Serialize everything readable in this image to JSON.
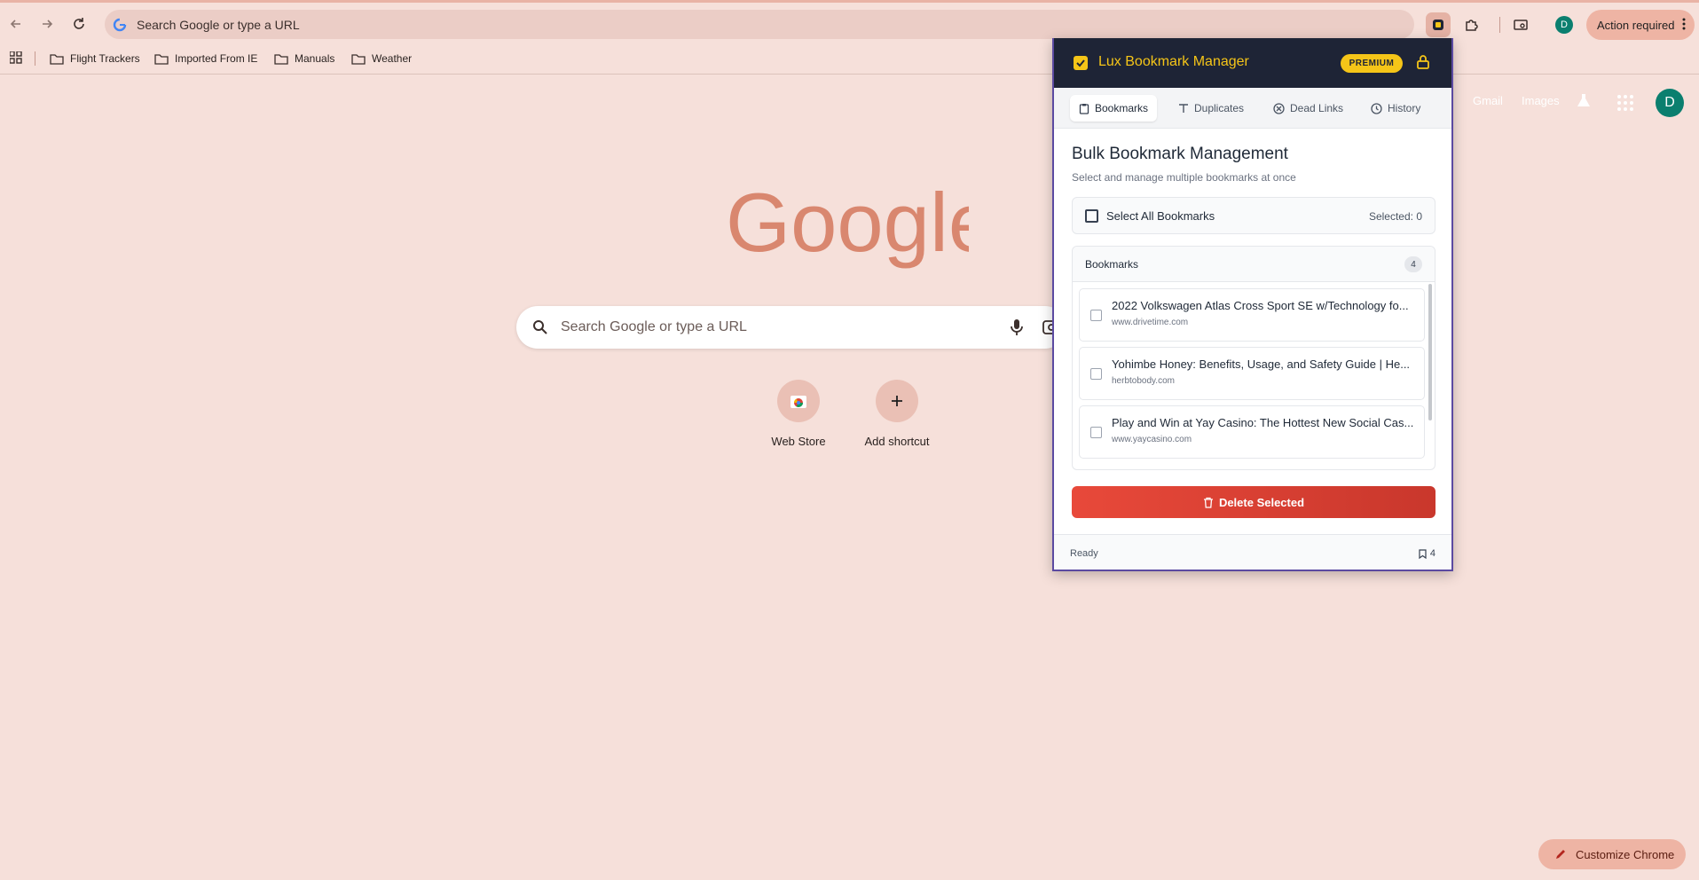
{
  "browser": {
    "omnibox_text": "Search Google or type a URL",
    "profile_initial": "D",
    "action_required_label": "Action required"
  },
  "bookmarks_bar": {
    "items": [
      {
        "label": "Flight Trackers",
        "icon": "folder-icon"
      },
      {
        "label": "Imported From IE",
        "icon": "folder-icon"
      },
      {
        "label": "Manuals",
        "icon": "folder-icon"
      },
      {
        "label": "Weather",
        "icon": "folder-icon"
      }
    ]
  },
  "ntp": {
    "logo_text": "Google",
    "search_placeholder": "Search Google or type a URL",
    "shortcuts": [
      {
        "label": "Web Store",
        "icon": "chrome-webstore-icon"
      },
      {
        "label": "Add shortcut",
        "icon": "plus-icon"
      }
    ],
    "header_links": [
      "Gmail",
      "Images"
    ],
    "avatar_initial": "D",
    "customize_label": "Customize Chrome"
  },
  "popup": {
    "title": "Lux Bookmark Manager",
    "badge": "PREMIUM",
    "tabs": [
      {
        "label": "Bookmarks",
        "icon": "clipboard-icon",
        "active": true
      },
      {
        "label": "Duplicates",
        "icon": "text-icon",
        "active": false
      },
      {
        "label": "Dead Links",
        "icon": "x-circle-icon",
        "active": false
      },
      {
        "label": "History",
        "icon": "clock-icon",
        "active": false
      }
    ],
    "heading": "Bulk Bookmark Management",
    "subheading": "Select and manage multiple bookmarks at once",
    "select_all_label": "Select All Bookmarks",
    "selected_count": "Selected: 0",
    "list_title": "Bookmarks",
    "list_count": "4",
    "items": [
      {
        "title": "2022 Volkswagen Atlas Cross Sport SE w/Technology fo...",
        "url": "www.drivetime.com"
      },
      {
        "title": "Yohimbe Honey: Benefits, Usage, and Safety Guide | He...",
        "url": "herbtobody.com"
      },
      {
        "title": "Play and Win at Yay Casino: The Hottest New Social Cas...",
        "url": "www.yaycasino.com"
      }
    ],
    "delete_label": "Delete Selected",
    "status": "Ready",
    "footer_count": "4",
    "colors": {
      "header_bg": "#1e2436",
      "accent": "#f5c518",
      "danger": "#e8493a"
    }
  }
}
